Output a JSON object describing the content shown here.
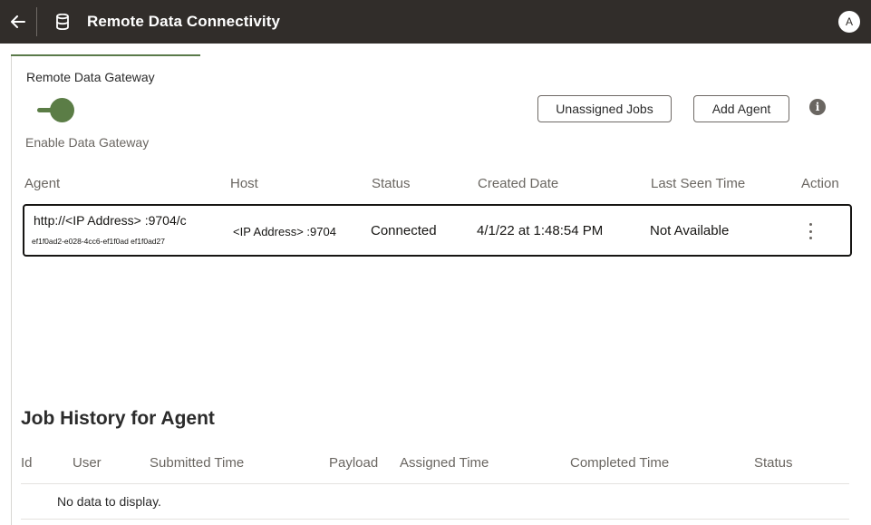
{
  "header": {
    "title": "Remote Data Connectivity",
    "avatar_initial": "A",
    "back_icon": "arrow-left-icon",
    "app_icon": "database-icon"
  },
  "gateway": {
    "title": "Remote Data Gateway",
    "toggle_enabled": true,
    "toggle_caption": "Enable Data Gateway"
  },
  "actions": {
    "unassigned_jobs": "Unassigned Jobs",
    "add_agent": "Add Agent",
    "info_icon": "info-icon"
  },
  "agents_table": {
    "columns": [
      "Agent",
      "Host",
      "Status",
      "Created Date",
      "Last Seen Time",
      "Action"
    ],
    "rows": [
      {
        "agent_url": "http://<IP Address> :9704/c",
        "agent_id": "ef1f0ad2-e028-4cc6-ef1f0ad ef1f0ad27",
        "host": "<IP Address> :9704",
        "status": "Connected",
        "created": "4/1/22 at 1:48:54 PM",
        "last_seen": "Not Available"
      }
    ]
  },
  "job_history": {
    "title": "Job History for Agent",
    "columns": [
      "Id",
      "User",
      "Submitted Time",
      "Payload",
      "Assigned Time",
      "Completed Time",
      "Status"
    ],
    "empty_text": "No data to display."
  },
  "colors": {
    "topbar": "#312d2a",
    "accent_green": "#5b7d46",
    "muted_text": "#6a6661"
  }
}
